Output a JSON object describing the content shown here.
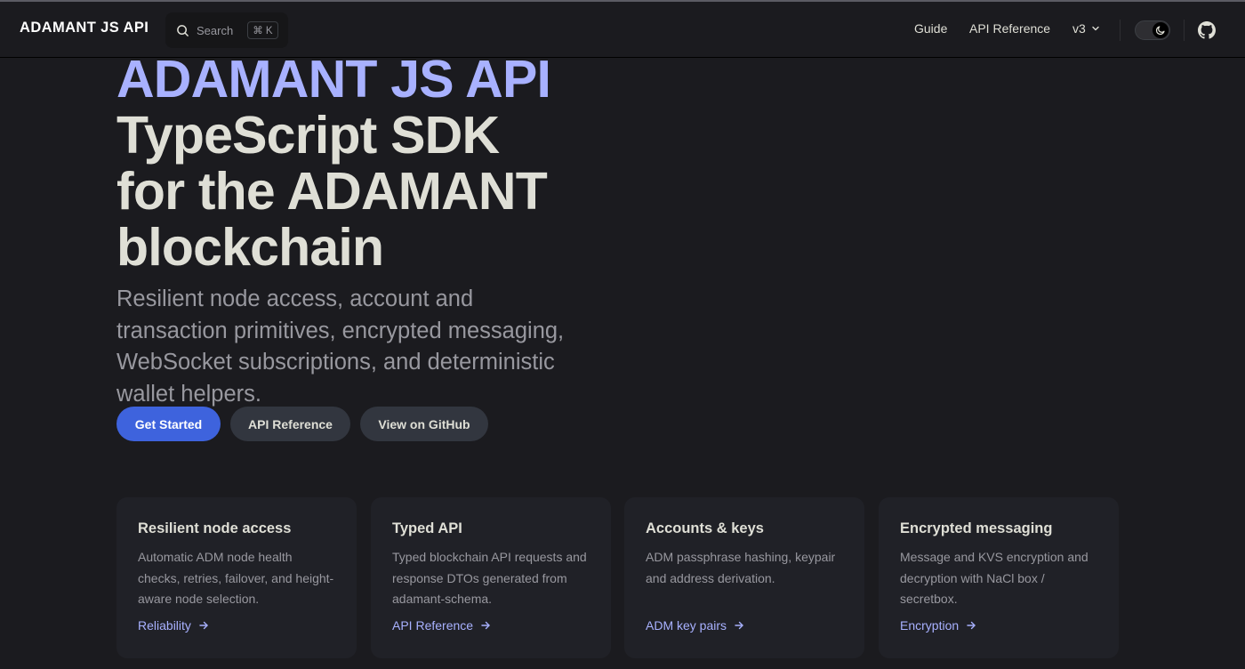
{
  "nav": {
    "brand": "ADAMANT JS API",
    "search_placeholder": "Search",
    "search_shortcut": "⌘ K",
    "links": [
      "Guide",
      "API Reference"
    ],
    "version": "v3"
  },
  "hero": {
    "name": "ADAMANT JS API",
    "text": "TypeScript SDK for the ADAMANT blockchain",
    "tagline": "Resilient node access, account and transaction primitives, encrypted messaging, WebSocket subscriptions, and deterministic wallet helpers.",
    "actions": [
      {
        "label": "Get Started",
        "theme": "brand"
      },
      {
        "label": "API Reference",
        "theme": "alt"
      },
      {
        "label": "View on GitHub",
        "theme": "alt"
      }
    ]
  },
  "features": [
    {
      "title": "Resilient node access",
      "details": "Automatic ADM node health checks, retries, failover, and height-aware node selection.",
      "link": "Reliability"
    },
    {
      "title": "Typed API",
      "details": "Typed blockchain API requests and response DTOs generated from adamant-schema.",
      "link": "API Reference"
    },
    {
      "title": "Accounts & keys",
      "details": "ADM passphrase hashing, keypair and address derivation.",
      "link": "ADM key pairs"
    },
    {
      "title": "Encrypted messaging",
      "details": "Message and KVS encryption and decryption with NaCl box / secretbox.",
      "link": "Encryption"
    }
  ],
  "colors": {
    "background": "#1b1b1f",
    "brand": "#a8b1ff",
    "primary_button": "#3e63dd",
    "alt_button": "#32363f",
    "card": "#202127"
  },
  "icons": [
    "search-icon",
    "chevron-down-icon",
    "moon-icon",
    "github-icon",
    "arrow-right-icon"
  ]
}
